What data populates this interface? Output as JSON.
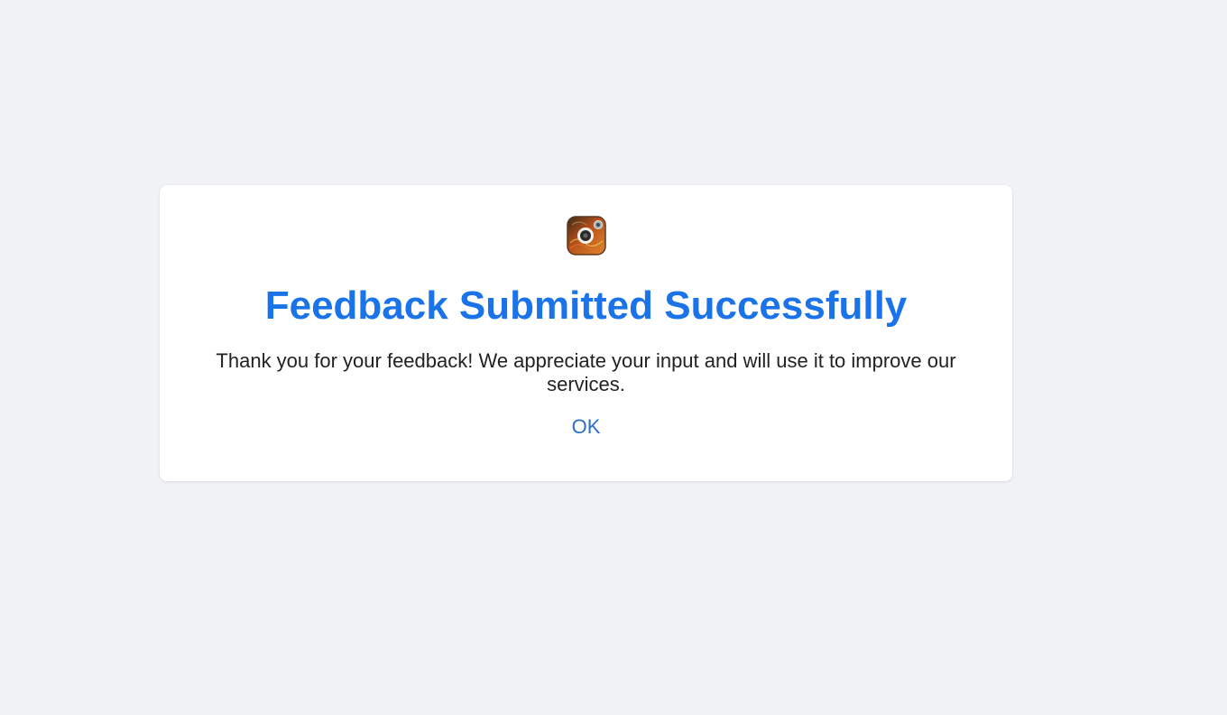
{
  "dialog": {
    "logo_icon": "camera-app-logo-icon",
    "title": "Feedback Submitted Successfully",
    "message": "Thank you for your feedback! We appreciate your input and will use it to improve our services.",
    "ok_label": "OK"
  },
  "colors": {
    "background": "#f0f2f5",
    "card": "#ffffff",
    "title": "#1a73e8",
    "link": "#2a6fc9",
    "text": "#222222"
  }
}
